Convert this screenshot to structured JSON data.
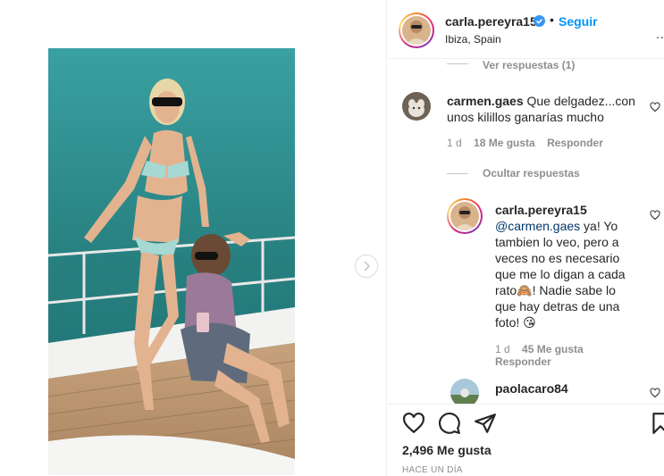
{
  "post": {
    "username": "carla.pereyra15",
    "follow_label": "Seguir",
    "separator": "•",
    "location": "Ibiza, Spain",
    "more_label": "..."
  },
  "comments": {
    "view_replies_top": "Ver respuestas (1)",
    "c1": {
      "username": "carmen.gaes",
      "text_line1": "Que delgadez...con",
      "text_line2": "unos kilillos ganarías mucho",
      "age": "1 d",
      "likes": "18 Me gusta",
      "reply": "Responder"
    },
    "hide_replies": "Ocultar respuestas",
    "reply1": {
      "username": "carla.pereyra15",
      "mention": "@carmen.gaes",
      "line1_rest": " ya! Yo",
      "line2": "tambien lo veo, pero a",
      "line3": "veces no es necesario",
      "line4": "que me lo digan a cada",
      "line5a": "rato",
      "emoji1": "🙈",
      "line5b": "! Nadie sabe lo",
      "line6": "que hay detras de una",
      "line7": "foto!",
      "emoji2": "😘",
      "age": "1 d",
      "likes": "45 Me gusta",
      "reply": "Responder"
    },
    "c2": {
      "username": "paolacaro84"
    }
  },
  "footer": {
    "likes": "2,496 Me gusta",
    "time": "HACE UN DÍA"
  },
  "colors": {
    "accent": "#0095f6",
    "mention": "#00376b",
    "muted": "#8e8e8e",
    "sea": "#2f8a8c"
  }
}
